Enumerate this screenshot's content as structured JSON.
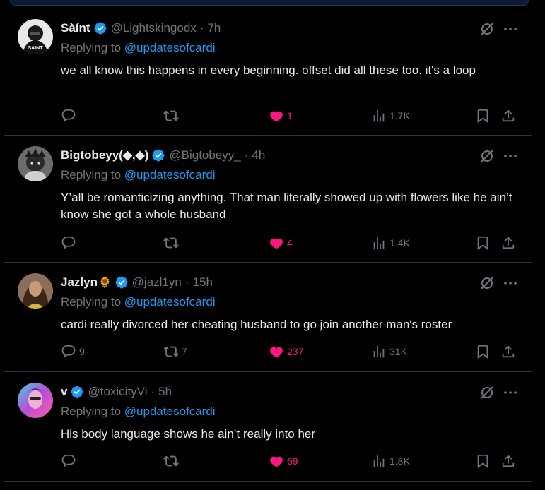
{
  "replies": [
    {
      "name": "Sàínt",
      "emoji": "",
      "handle": "@Lightskingodx",
      "time": "7h",
      "replying_prefix": "Replying to ",
      "mention": "@updatesofcardi",
      "text": "we all know this happens in every beginning. offset did all these too. it's a loop",
      "replies_count": "",
      "reposts_count": "",
      "likes_count": "1",
      "views_count": "1.7K",
      "avatar_caption": "SAINT"
    },
    {
      "name": "Bigtobeyy(◆,◆)",
      "emoji": "",
      "handle": "@Bigtobeyy_",
      "time": "4h",
      "replying_prefix": "Replying to ",
      "mention": "@updatesofcardi",
      "text": "Y’all be romanticizing anything. That man literally showed up with flowers like he ain’t know she got a whole husband",
      "replies_count": "",
      "reposts_count": "",
      "likes_count": "4",
      "views_count": "1.4K"
    },
    {
      "name": "Jazlyn",
      "emoji": "🌻",
      "handle": "@jazl1yn",
      "time": "15h",
      "replying_prefix": "Replying to ",
      "mention": "@updatesofcardi",
      "text": "cardi really divorced her cheating husband to go join another man's roster",
      "replies_count": "9",
      "reposts_count": "7",
      "likes_count": "237",
      "views_count": "31K"
    },
    {
      "name": "v",
      "emoji": "",
      "handle": "@toxicityVi",
      "time": "5h",
      "replying_prefix": "Replying to ",
      "mention": "@updatesofcardi",
      "text": "His body language shows he ain’t really into her",
      "replies_count": "",
      "reposts_count": "",
      "likes_count": "69",
      "views_count": "1.8K"
    }
  ],
  "colors": {
    "background": "#000000",
    "text": "#e7e9ea",
    "muted": "#71767b",
    "link": "#1d9bf0",
    "like": "#f91880",
    "divider": "#2f3336"
  },
  "icons": [
    "verified-badge-icon",
    "grok-icon",
    "more-icon",
    "reply-icon",
    "repost-icon",
    "like-icon",
    "views-icon",
    "bookmark-icon",
    "share-icon"
  ]
}
